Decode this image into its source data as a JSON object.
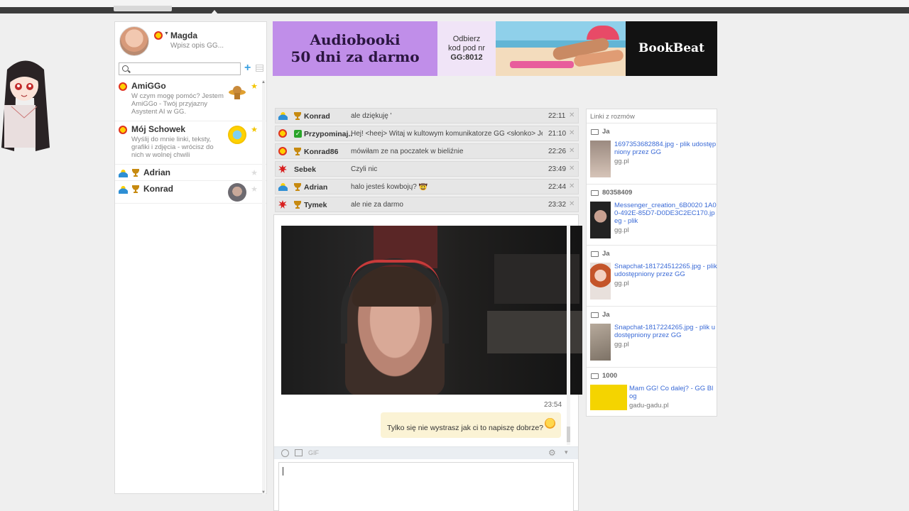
{
  "profile": {
    "name": "Magda",
    "description": "Wpisz opis GG..."
  },
  "sidebar": {
    "contacts": [
      {
        "name": "AmiGGo",
        "description": "W czym mogę pomóc? Jestem AmiGGo - Twój przyjazny Asystent AI w GG."
      },
      {
        "name": "Mój Schowek",
        "description": "Wyślij do mnie linki, teksty, grafiki i zdjęcia - wrócisz do nich w wolnej chwili"
      },
      {
        "name": "Adrian"
      },
      {
        "name": "Konrad"
      }
    ]
  },
  "banner": {
    "headline": "Audiobooki",
    "subline": "50 dni za darmo",
    "promo_1": "Odbierz",
    "promo_2": "kod pod nr",
    "promo_code": "GG:8012",
    "brand": "BookBeat"
  },
  "chats": [
    {
      "name": "Konrad",
      "message": "ale dziękuję '",
      "time": "22:11"
    },
    {
      "name": "Przypominaj...",
      "message": "Hej! <heej> Witaj w kultowym komunikatorze GG <słonko> Jest...",
      "time": "21:10"
    },
    {
      "name": "Konrad86",
      "message": "mówiłam ze na poczatek w bieliźnie",
      "time": "22:26"
    },
    {
      "name": "Sebek",
      "message": "Czyli nic",
      "time": "23:49"
    },
    {
      "name": "Adrian",
      "message": "halo jesteś kowbojų? 🤠",
      "time": "22:44"
    },
    {
      "name": "Tymek",
      "message": "ale nie za darmo",
      "time": "23:32"
    }
  ],
  "conversation": {
    "timestamp": "23:54",
    "bubble": "Tylko się nie wystrasz jak ci to napiszę dobrze?",
    "gif_label": "GIF"
  },
  "links_panel": {
    "header": "Linki z rozmów",
    "items": [
      {
        "sender": "Ja",
        "title": "1697353682884.jpg - plik udostępniony przez GG",
        "domain": "gg.pl"
      },
      {
        "sender": "80358409",
        "title": "Messenger_creation_6B0020 1A00-492E-85D7-D0DE3C2EC170.jpeg - plik",
        "domain": "gg.pl"
      },
      {
        "sender": "Ja",
        "title": "Snapchat-181724512265.jpg - plik udostępniony przez GG",
        "domain": "gg.pl"
      },
      {
        "sender": "Ja",
        "title": "Snapchat-1817224265.jpg - plik udostępniony przez GG",
        "domain": "gg.pl"
      },
      {
        "sender": "1000",
        "title": "Mam GG! Co dalej? - GG Blog",
        "domain": "gadu-gadu.pl"
      }
    ]
  },
  "colors": {
    "accent": "#3aa0e0",
    "banner_purple": "#c08ee9",
    "bubble": "#fbf3d5",
    "link": "#3a6ad6"
  }
}
